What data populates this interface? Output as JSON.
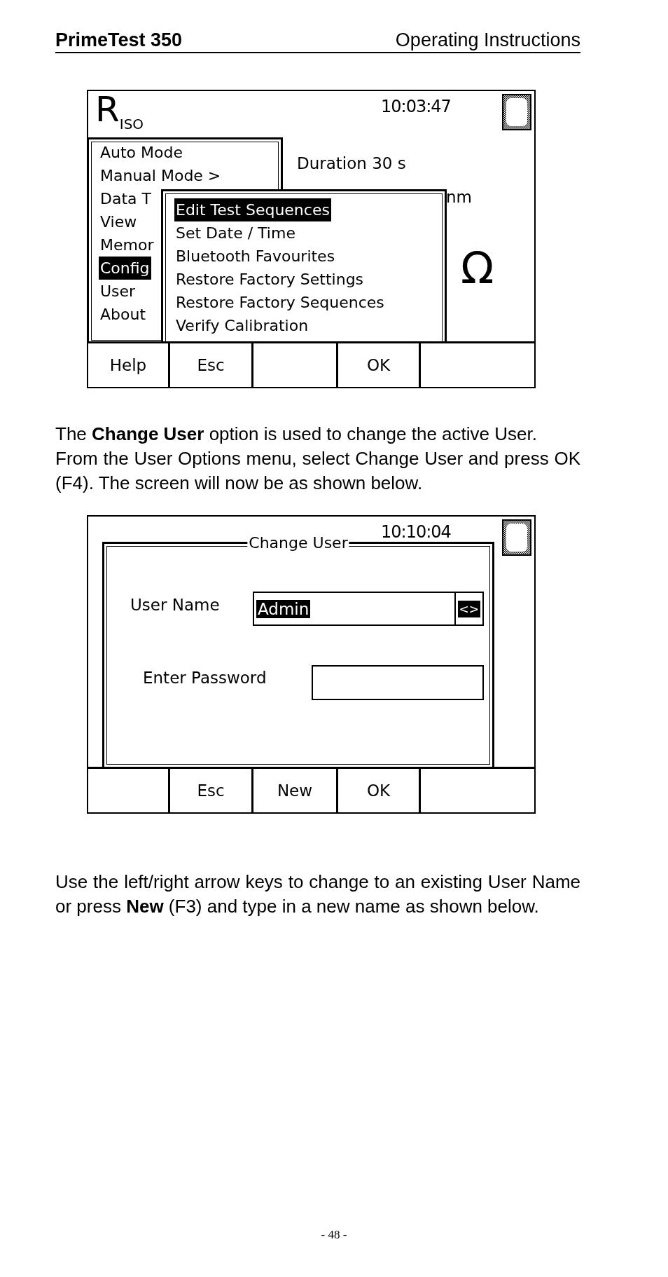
{
  "header": {
    "product": "PrimeTest 350",
    "section": "Operating Instructions"
  },
  "content": [
    {
      "kind": "screen",
      "title": "R$_{ISO}$",
      "time": "10:03:47",
      "background_texts": [
        {
          "kind": "duration",
          "text": "Duration 30 s"
        },
        {
          "kind": "fragment",
          "text": "nm"
        },
        {
          "kind": "unit",
          "text": "Ω"
        }
      ],
      "menu": [
        {
          "label": "Auto Mode",
          "selected": false
        },
        {
          "label": "Manual Mode >",
          "selected": false
        },
        {
          "label": "Data T",
          "selected": false
        },
        {
          "label": "View",
          "selected": false
        },
        {
          "label": "Memor",
          "selected": false
        },
        {
          "label": "Config",
          "selected": true
        },
        {
          "label": "User",
          "selected": false
        },
        {
          "label": "About",
          "selected": false
        }
      ],
      "submenu": [
        {
          "label": "Edit Test Sequences",
          "selected": true
        },
        {
          "label": "Set Date / Time",
          "selected": false
        },
        {
          "label": "Bluetooth Favourites",
          "selected": false
        },
        {
          "label": "Restore Factory Settings",
          "selected": false
        },
        {
          "label": "Restore Factory Sequences",
          "selected": false
        },
        {
          "label": "Verify Calibration",
          "selected": false
        }
      ],
      "keys": [
        {
          "kind": "key",
          "label": "Help"
        },
        {
          "kind": "key",
          "label": "Esc"
        },
        {
          "kind": "blank"
        },
        {
          "kind": "key",
          "label": "OK"
        },
        {
          "kind": "blank"
        }
      ]
    },
    {
      "kind": "paragraph",
      "text": "The **Change User** option is used to change the active User."
    },
    {
      "kind": "paragraph",
      "text": "From the User Options menu, select Change User and press OK (F4). The screen will now be as shown below."
    },
    {
      "kind": "screen",
      "time": "10:10:04",
      "dialog": {
        "title": "Change User",
        "fields": [
          {
            "kind": "selector",
            "label": "User Name",
            "value": "Admin",
            "selected": true,
            "arrows": "<>"
          },
          {
            "kind": "text",
            "label": "Enter Password"
          }
        ]
      },
      "keys": [
        {
          "kind": "blank"
        },
        {
          "kind": "key",
          "label": "Esc"
        },
        {
          "kind": "key",
          "label": "New"
        },
        {
          "kind": "key",
          "label": "OK"
        },
        {
          "kind": "blank"
        }
      ]
    },
    {
      "kind": "paragraph",
      "text": "Use the left/right arrow keys to change to an existing User Name or press **New** (F3) and type in a new name as shown below."
    }
  ],
  "page_number": "- 48 -"
}
